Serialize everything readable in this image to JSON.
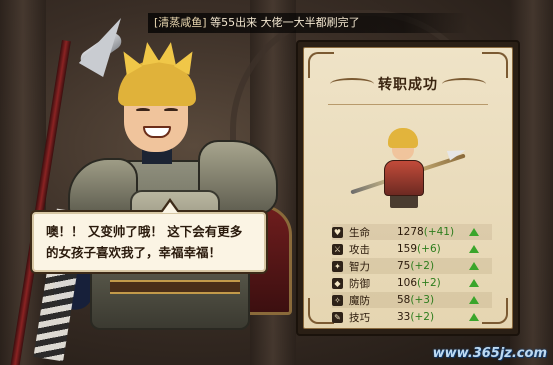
{
  "chat": {
    "sender": "[清蒸咸鱼]",
    "message": "等55出来 大佬一大半都刷完了"
  },
  "dialogue": {
    "line1": "噢！！ 又变帅了哦！ 这下会有更多",
    "line2": "的女孩子喜欢我了，幸福幸福！"
  },
  "panel": {
    "title": "转职成功",
    "stats": [
      {
        "icon": "heart-icon",
        "glyph": "♥",
        "name": "生命",
        "value": "1278",
        "delta": "(+41)"
      },
      {
        "icon": "sword-icon",
        "glyph": "⚔",
        "name": "攻击",
        "value": "159",
        "delta": "(+6)"
      },
      {
        "icon": "brain-icon",
        "glyph": "✦",
        "name": "智力",
        "value": "75",
        "delta": "(+2)"
      },
      {
        "icon": "shield-icon",
        "glyph": "◆",
        "name": "防御",
        "value": "106",
        "delta": "(+2)"
      },
      {
        "icon": "magic-shield-icon",
        "glyph": "✧",
        "name": "魔防",
        "value": "58",
        "delta": "(+3)"
      },
      {
        "icon": "skill-icon",
        "glyph": "✎",
        "name": "技巧",
        "value": "33",
        "delta": "(+2)"
      }
    ]
  },
  "watermark": "www.365jz.com"
}
